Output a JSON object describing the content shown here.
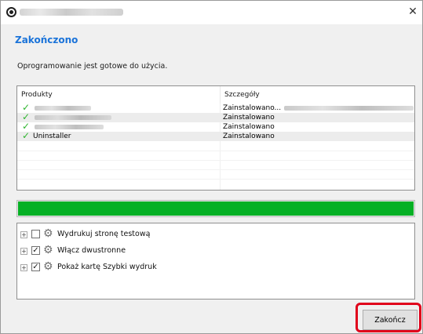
{
  "window": {
    "close_glyph": "✕"
  },
  "main": {
    "heading": "Zakończono",
    "subtext": "Oprogramowanie jest gotowe do użycia."
  },
  "product_list": {
    "columns": [
      "Produkty",
      "Szczegóły"
    ],
    "rows": [
      {
        "name": "",
        "status": "Zainstalowano...",
        "installed": true
      },
      {
        "name": "",
        "status": "Zainstalowano",
        "installed": true
      },
      {
        "name": "",
        "status": "Zainstalowano",
        "installed": true
      },
      {
        "name": "Uninstaller",
        "status": "Zainstalowano",
        "installed": true
      }
    ]
  },
  "progress": {
    "fraction": 1.0,
    "color": "#06b025"
  },
  "options": [
    {
      "label": "Wydrukuj stronę testową",
      "checked": false,
      "icon": "gear-icon"
    },
    {
      "label": "Włącz dwustronne",
      "checked": true,
      "icon": "gear-icon"
    },
    {
      "label": "Pokaż kartę Szybki wydruk",
      "checked": true,
      "icon": "gear-icon"
    }
  ],
  "footer": {
    "finish_label": "Zakończ",
    "highlight_color": "#e0001b"
  },
  "colors": {
    "heading": "#1a73d9",
    "check": "#2fb52f"
  }
}
